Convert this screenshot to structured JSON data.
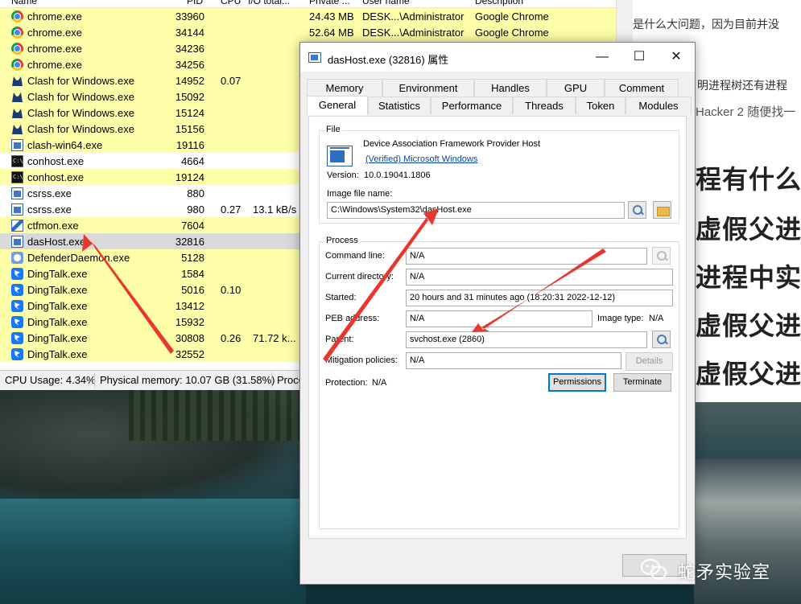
{
  "process_list": {
    "header": {
      "name": "Name",
      "pid": "PID",
      "cpu": "CPU",
      "io": "I/O total...",
      "private": "Private ...",
      "user": "User name",
      "desc": "Description"
    },
    "rows": [
      {
        "icon": "chrome-icon",
        "name": "chrome.exe",
        "pid": "33960",
        "cpu": "",
        "io": "",
        "priv": "24.43 MB",
        "user": "DESK...\\Administrator",
        "desc": "Google Chrome",
        "bg": "#ffffaa"
      },
      {
        "icon": "chrome-icon",
        "name": "chrome.exe",
        "pid": "34144",
        "cpu": "",
        "io": "",
        "priv": "52.64 MB",
        "user": "DESK...\\Administrator",
        "desc": "Google Chrome",
        "bg": "#ffffaa"
      },
      {
        "icon": "chrome-icon",
        "name": "chrome.exe",
        "pid": "34236",
        "cpu": "",
        "io": "",
        "priv": "",
        "user": "",
        "desc": "",
        "bg": "#ffffaa"
      },
      {
        "icon": "chrome-icon",
        "name": "chrome.exe",
        "pid": "34256",
        "cpu": "",
        "io": "",
        "priv": "",
        "user": "",
        "desc": "",
        "bg": "#ffffaa"
      },
      {
        "icon": "clash-icon",
        "name": "Clash for Windows.exe",
        "pid": "14952",
        "cpu": "0.07",
        "io": "",
        "priv": "",
        "user": "",
        "desc": "",
        "bg": "#ffffaa"
      },
      {
        "icon": "clash-icon",
        "name": "Clash for Windows.exe",
        "pid": "15092",
        "cpu": "",
        "io": "",
        "priv": "",
        "user": "",
        "desc": "",
        "bg": "#ffffaa"
      },
      {
        "icon": "clash-icon",
        "name": "Clash for Windows.exe",
        "pid": "15124",
        "cpu": "",
        "io": "",
        "priv": "",
        "user": "",
        "desc": "",
        "bg": "#ffffaa"
      },
      {
        "icon": "clash-icon",
        "name": "Clash for Windows.exe",
        "pid": "15156",
        "cpu": "",
        "io": "",
        "priv": "",
        "user": "",
        "desc": "",
        "bg": "#ffffaa"
      },
      {
        "icon": "window-icon",
        "name": "clash-win64.exe",
        "pid": "19116",
        "cpu": "",
        "io": "",
        "priv": "",
        "user": "",
        "desc": "",
        "bg": "#ffffaa"
      },
      {
        "icon": "console-icon",
        "name": "conhost.exe",
        "pid": "4664",
        "cpu": "",
        "io": "",
        "priv": "",
        "user": "",
        "desc": "",
        "bg": "#ffffff"
      },
      {
        "icon": "console-icon",
        "name": "conhost.exe",
        "pid": "19124",
        "cpu": "",
        "io": "",
        "priv": "",
        "user": "",
        "desc": "",
        "bg": "#ffffaa"
      },
      {
        "icon": "window-icon",
        "name": "csrss.exe",
        "pid": "880",
        "cpu": "",
        "io": "",
        "priv": "",
        "user": "",
        "desc": "",
        "bg": "#ffffff"
      },
      {
        "icon": "window-icon",
        "name": "csrss.exe",
        "pid": "980",
        "cpu": "0.27",
        "io": "13.1 kB/s",
        "priv": "",
        "user": "",
        "desc": "",
        "bg": "#ffffff"
      },
      {
        "icon": "ctfmon-icon",
        "name": "ctfmon.exe",
        "pid": "7604",
        "cpu": "",
        "io": "",
        "priv": "",
        "user": "",
        "desc": "",
        "bg": "#ffffaa"
      },
      {
        "icon": "window-icon",
        "name": "dasHost.exe",
        "pid": "32816",
        "cpu": "",
        "io": "",
        "priv": "",
        "user": "",
        "desc": "",
        "bg": "#d9d9d9"
      },
      {
        "icon": "defender-icon",
        "name": "DefenderDaemon.exe",
        "pid": "5128",
        "cpu": "",
        "io": "",
        "priv": "",
        "user": "",
        "desc": "",
        "bg": "#ffffaa"
      },
      {
        "icon": "dingtalk-icon",
        "name": "DingTalk.exe",
        "pid": "1584",
        "cpu": "",
        "io": "",
        "priv": "",
        "user": "",
        "desc": "",
        "bg": "#ffffaa"
      },
      {
        "icon": "dingtalk-icon",
        "name": "DingTalk.exe",
        "pid": "5016",
        "cpu": "0.10",
        "io": "",
        "priv": "",
        "user": "",
        "desc": "",
        "bg": "#ffffaa"
      },
      {
        "icon": "dingtalk-icon",
        "name": "DingTalk.exe",
        "pid": "13412",
        "cpu": "",
        "io": "",
        "priv": "",
        "user": "",
        "desc": "",
        "bg": "#ffffaa"
      },
      {
        "icon": "dingtalk-icon",
        "name": "DingTalk.exe",
        "pid": "15932",
        "cpu": "",
        "io": "",
        "priv": "",
        "user": "",
        "desc": "",
        "bg": "#ffffaa"
      },
      {
        "icon": "dingtalk-icon",
        "name": "DingTalk.exe",
        "pid": "30808",
        "cpu": "0.26",
        "io": "71.72 k...",
        "priv": "",
        "user": "",
        "desc": "",
        "bg": "#ffffaa"
      },
      {
        "icon": "dingtalk-icon",
        "name": "DingTalk.exe",
        "pid": "32552",
        "cpu": "",
        "io": "",
        "priv": "",
        "user": "",
        "desc": "",
        "bg": "#ffffaa"
      }
    ],
    "status": {
      "cpu": "CPU Usage: 4.34%",
      "mem": "Physical memory: 10.07 GB (31.58%)",
      "proc": "Proce"
    }
  },
  "article": {
    "line1": "是什么大问题，因为目前并没",
    "line2": "明进程树还有进程",
    "line3": "Hacker 2 随便找一",
    "h1": "程有什么",
    "h2": "虚假父进",
    "h3": "进程中实",
    "h4": "虚假父进",
    "h5": "虚假父进"
  },
  "dialog": {
    "title": "dasHost.exe (32816) 属性",
    "tabs_row1": [
      "Memory",
      "Environment",
      "Handles",
      "GPU",
      "Comment"
    ],
    "tabs_row2": [
      "General",
      "Statistics",
      "Performance",
      "Threads",
      "Token",
      "Modules"
    ],
    "file": {
      "group_label": "File",
      "description": "Device Association Framework Provider Host",
      "verified": "(Verified) Microsoft Windows",
      "version_label": "Version:",
      "version": "10.0.19041.1806",
      "image_label": "Image file name:",
      "image_path": "C:\\Windows\\System32\\dasHost.exe"
    },
    "process": {
      "group_label": "Process",
      "command_line_label": "Command line:",
      "command_line": "N/A",
      "cwd_label": "Current directory:",
      "cwd": "N/A",
      "started_label": "Started:",
      "started": "20 hours and 31 minutes ago (18:20:31 2022-12-12)",
      "peb_label": "PEB address:",
      "peb": "N/A",
      "image_type_label": "Image type:",
      "image_type": "N/A",
      "parent_label": "Parent:",
      "parent": "svchost.exe (2860)",
      "mitigation_label": "Mitigation policies:",
      "mitigation": "N/A",
      "details_button": "Details",
      "protection_label": "Protection:",
      "protection": "N/A",
      "permissions_button": "Permissions",
      "terminate_button": "Terminate"
    }
  },
  "watermark": {
    "text": "蛇矛实验室"
  },
  "colors": {
    "highlight_yellow": "#ffffaa",
    "selected_row": "#d9d9d9",
    "arrow_red": "#e8372d",
    "accent_blue": "#0078d7"
  }
}
